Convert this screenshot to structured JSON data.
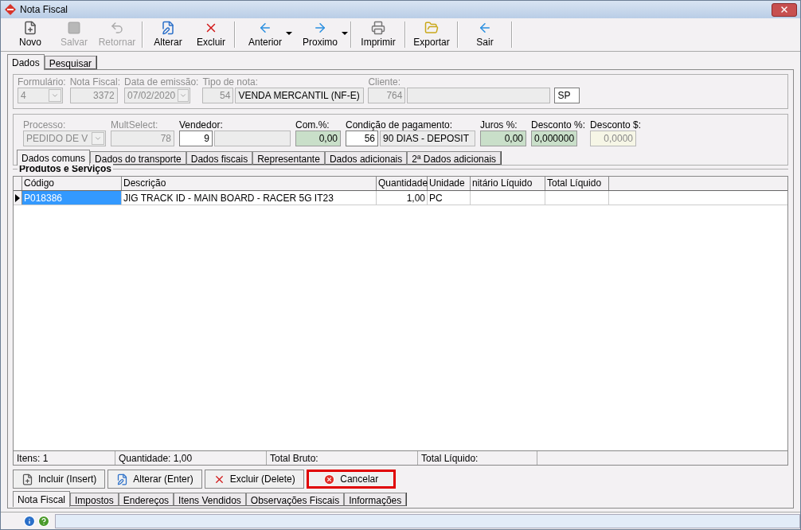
{
  "window": {
    "title": "Nota Fiscal"
  },
  "toolbar": [
    {
      "label": "Novo",
      "kind": "new",
      "disabled": false,
      "dropdown": false
    },
    {
      "label": "Salvar",
      "kind": "save",
      "disabled": true,
      "dropdown": false
    },
    {
      "label": "Retornar",
      "kind": "undo",
      "disabled": true,
      "dropdown": false
    },
    {
      "label": "Alterar",
      "kind": "edit",
      "disabled": false,
      "dropdown": false
    },
    {
      "label": "Excluir",
      "kind": "delete",
      "disabled": false,
      "dropdown": false
    },
    {
      "label": "Anterior",
      "kind": "back",
      "disabled": false,
      "dropdown": true
    },
    {
      "label": "Proximo",
      "kind": "forward",
      "disabled": false,
      "dropdown": true
    },
    {
      "label": "Imprimir",
      "kind": "print",
      "disabled": false,
      "dropdown": false
    },
    {
      "label": "Exportar",
      "kind": "export",
      "disabled": false,
      "dropdown": false
    },
    {
      "label": "Sair",
      "kind": "exit",
      "disabled": false,
      "dropdown": false
    }
  ],
  "top_tabs": [
    {
      "label": "Dados",
      "selected": true
    },
    {
      "label": "Pesquisar",
      "selected": false
    }
  ],
  "header_fields": [
    {
      "label": "Formulário:",
      "disabled": true,
      "kind": "combo",
      "values": [
        {
          "text": "4",
          "kind": "disabled"
        }
      ]
    },
    {
      "label": "Nota Fiscal:",
      "disabled": true,
      "kind": "text",
      "values": [
        {
          "text": "3372",
          "kind": "disabled"
        }
      ]
    },
    {
      "label": "Data de emissão:",
      "disabled": true,
      "kind": "combo",
      "values": [
        {
          "text": "07/02/2020",
          "kind": "disabled"
        }
      ]
    },
    {
      "label": "Tipo de nota:",
      "disabled": true,
      "kind": "text",
      "values": [
        {
          "text": "54",
          "kind": "disabled"
        },
        {
          "text": "VENDA MERCANTIL (NF-E)",
          "kind": "readonly"
        }
      ]
    },
    {
      "label": "Cliente:",
      "disabled": true,
      "kind": "text",
      "values": [
        {
          "text": "764",
          "kind": "disabled"
        },
        {
          "kind": "readonly"
        }
      ]
    },
    {
      "kind": "text",
      "values": [
        {
          "text": "SP",
          "kind": "white"
        }
      ]
    }
  ],
  "detail_fields": [
    {
      "label": "Processo:",
      "disabled": true,
      "kind": "combo",
      "values": [
        {
          "text": "PEDIDO DE V",
          "kind": "disabled"
        }
      ]
    },
    {
      "label": "MultSelect:",
      "disabled": true,
      "kind": "text",
      "values": [
        {
          "text": "78",
          "kind": "disabled"
        }
      ]
    },
    {
      "label": "Vendedor:",
      "disabled": false,
      "kind": "text",
      "values": [
        {
          "text": "9",
          "kind": "white"
        },
        {
          "kind": "readonly"
        }
      ]
    },
    {
      "label": "Com.%:",
      "disabled": false,
      "kind": "text",
      "values": [
        {
          "text": "0,00",
          "kind": "green"
        }
      ]
    },
    {
      "label": "Condição de pagamento:",
      "disabled": false,
      "kind": "text",
      "values": [
        {
          "text": "56",
          "kind": "white"
        },
        {
          "text": "90 DIAS - DEPOSIT",
          "kind": "readonly"
        }
      ]
    },
    {
      "label": "Juros %:",
      "disabled": false,
      "kind": "text",
      "values": [
        {
          "text": "0,00",
          "kind": "green"
        }
      ]
    },
    {
      "label": "Desconto %:",
      "disabled": false,
      "kind": "text",
      "values": [
        {
          "text": "0,000000",
          "kind": "green"
        }
      ]
    },
    {
      "label": "Desconto $:",
      "disabled": false,
      "kind": "text",
      "values": [
        {
          "text": "0,0000",
          "kind": "cream"
        }
      ]
    }
  ],
  "detail_tabs": [
    {
      "label": "Dados comuns",
      "selected": true
    },
    {
      "label": "Dados do transporte",
      "selected": false
    },
    {
      "label": "Dados fiscais",
      "selected": false
    },
    {
      "label": "Representante",
      "selected": false
    },
    {
      "label": "Dados adicionais",
      "selected": false
    },
    {
      "label": "2ª Dados adicionais",
      "selected": false
    }
  ],
  "products": {
    "title": "Produtos e Serviços",
    "columns": [
      "Código",
      "Descrição",
      "Quantidade",
      "Unidade",
      "nitário Líquido",
      "Total Líquido"
    ],
    "rows": [
      {
        "selected": true,
        "cells": [
          "P018386",
          "JIG TRACK ID - MAIN BOARD - RACER 5G IT23",
          "1,00",
          "PC"
        ]
      }
    ],
    "summary": [
      "Itens: 1",
      "Quantidade: 1,00",
      "Total Bruto:",
      "Total Líquido:"
    ]
  },
  "actions": [
    {
      "label": "Incluir (Insert)",
      "kind": "new",
      "highlighted": false
    },
    {
      "label": "Alterar (Enter)",
      "kind": "edit",
      "highlighted": false
    },
    {
      "label": "Excluir (Delete)",
      "kind": "delete",
      "highlighted": false
    },
    {
      "label": "Cancelar",
      "kind": "cancel",
      "highlighted": true
    }
  ],
  "bottom_tabs": [
    {
      "label": "Nota Fiscal",
      "selected": true
    },
    {
      "label": "Impostos",
      "selected": false
    },
    {
      "label": "Endereços",
      "selected": false
    },
    {
      "label": "Itens Vendidos",
      "selected": false
    },
    {
      "label": "Observações Fiscais",
      "selected": false
    },
    {
      "label": "Informações",
      "selected": false
    }
  ]
}
